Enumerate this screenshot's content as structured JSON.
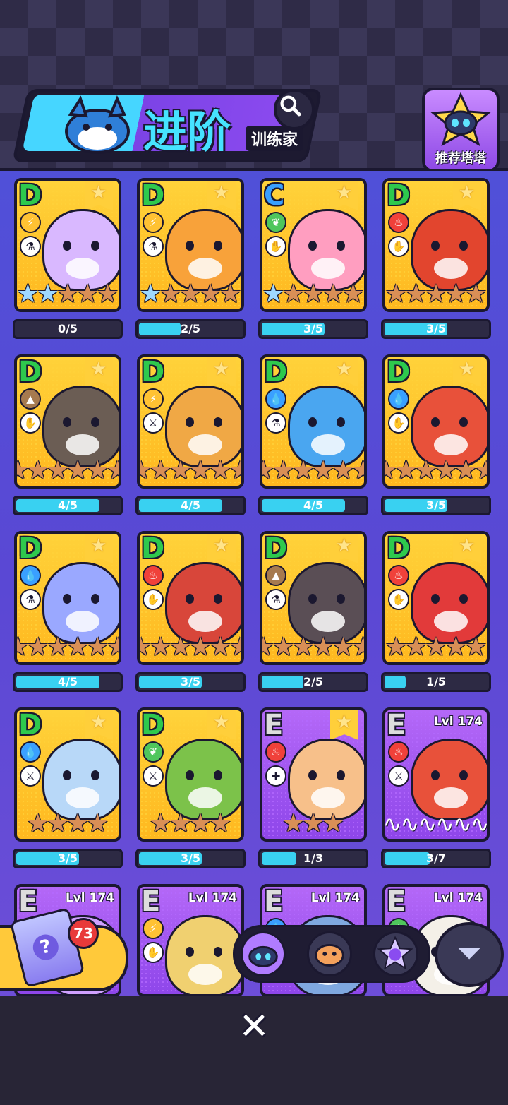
{
  "header": {
    "title": "进阶",
    "subtitle": "训练家",
    "recommend_label": "推荐塔塔"
  },
  "cards": [
    {
      "rank": "D",
      "element": "lightning",
      "role": "potion",
      "favorite": true,
      "stars": 5,
      "blue_stars": 2,
      "progress": "0/5",
      "progress_value": 0.0,
      "pet_color": "#d9b8ff"
    },
    {
      "rank": "D",
      "element": "lightning",
      "role": "potion",
      "favorite": true,
      "stars": 5,
      "blue_stars": 1,
      "progress": "2/5",
      "progress_value": 0.4,
      "pet_color": "#f8a23a"
    },
    {
      "rank": "C",
      "element": "leaf",
      "role": "claw",
      "favorite": true,
      "stars": 5,
      "blue_stars": 1,
      "progress": "3/5",
      "progress_value": 0.6,
      "pet_color": "#ff9ec0"
    },
    {
      "rank": "D",
      "element": "fire",
      "role": "claw",
      "favorite": true,
      "stars": 5,
      "blue_stars": 0,
      "progress": "3/5",
      "progress_value": 0.6,
      "pet_color": "#e2452e"
    },
    {
      "rank": "D",
      "element": "earth",
      "role": "claw",
      "favorite": true,
      "stars": 6,
      "blue_stars": 0,
      "progress": "4/5",
      "progress_value": 0.8,
      "pet_color": "#6b5d54"
    },
    {
      "rank": "D",
      "element": "lightning",
      "role": "sword",
      "favorite": true,
      "stars": 6,
      "blue_stars": 0,
      "progress": "4/5",
      "progress_value": 0.8,
      "pet_color": "#f0a845"
    },
    {
      "rank": "D",
      "element": "water",
      "role": "potion",
      "favorite": true,
      "stars": 6,
      "blue_stars": 0,
      "progress": "4/5",
      "progress_value": 0.8,
      "pet_color": "#4aa6f0"
    },
    {
      "rank": "D",
      "element": "water",
      "role": "claw",
      "favorite": true,
      "stars": 6,
      "blue_stars": 0,
      "progress": "3/5",
      "progress_value": 0.6,
      "pet_color": "#e8513a"
    },
    {
      "rank": "D",
      "element": "water",
      "role": "potion",
      "favorite": true,
      "stars": 6,
      "blue_stars": 0,
      "progress": "4/5",
      "progress_value": 0.8,
      "pet_color": "#9aa8ff"
    },
    {
      "rank": "D",
      "element": "fire",
      "role": "claw",
      "favorite": true,
      "stars": 6,
      "blue_stars": 0,
      "progress": "3/5",
      "progress_value": 0.6,
      "pet_color": "#d8463a"
    },
    {
      "rank": "D",
      "element": "earth",
      "role": "potion",
      "favorite": true,
      "stars": 6,
      "blue_stars": 0,
      "progress": "2/5",
      "progress_value": 0.4,
      "pet_color": "#5a4e55"
    },
    {
      "rank": "D",
      "element": "fire",
      "role": "claw",
      "favorite": true,
      "stars": 5,
      "blue_stars": 0,
      "progress": "1/5",
      "progress_value": 0.2,
      "pet_color": "#e23a3a"
    },
    {
      "rank": "D",
      "element": "water",
      "role": "sword",
      "favorite": true,
      "stars": 4,
      "blue_stars": 0,
      "progress": "3/5",
      "progress_value": 0.6,
      "pet_color": "#b8d8f8"
    },
    {
      "rank": "D",
      "element": "leaf",
      "role": "sword",
      "favorite": true,
      "stars": 4,
      "blue_stars": 0,
      "progress": "3/5",
      "progress_value": 0.6,
      "pet_color": "#7cc24a"
    },
    {
      "rank": "E",
      "element": "fire",
      "role": "heal",
      "favorite": true,
      "stars": 3,
      "blue_stars": 0,
      "progress": "1/3",
      "progress_value": 0.33,
      "pet_color": "#f7c08a"
    },
    {
      "rank": "E",
      "element": "fire",
      "role": "sword",
      "favorite": false,
      "level": "Lvl 174",
      "stars": 0,
      "blue_stars": 0,
      "waves": 6,
      "progress": "3/7",
      "progress_value": 0.43,
      "pet_color": "#e8513a"
    },
    {
      "rank": "E",
      "element": "earth",
      "role": "claw",
      "favorite": false,
      "level": "Lvl 174",
      "stars": 0,
      "blue_stars": 0,
      "progress": "",
      "progress_value": 0,
      "pet_color": "#cfa0ff"
    },
    {
      "rank": "E",
      "element": "lightning",
      "role": "claw",
      "favorite": false,
      "level": "Lvl 174",
      "stars": 0,
      "blue_stars": 0,
      "progress": "",
      "progress_value": 0,
      "pet_color": "#f0d070"
    },
    {
      "rank": "E",
      "element": "water",
      "role": "claw",
      "favorite": false,
      "level": "Lvl 174",
      "stars": 0,
      "blue_stars": 0,
      "progress": "",
      "progress_value": 0,
      "pet_color": "#7fa8e0"
    },
    {
      "rank": "E",
      "element": "leaf",
      "role": "claw",
      "favorite": false,
      "level": "Lvl 174",
      "stars": 0,
      "blue_stars": 0,
      "progress": "",
      "progress_value": 0,
      "pet_color": "#f4f0e8"
    }
  ],
  "lucky_box": {
    "count": "73"
  },
  "element_colors": {
    "lightning": "#ffc233",
    "leaf": "#4fc65c",
    "fire": "#f0413a",
    "earth": "#a67a4f",
    "water": "#3aa0ff"
  },
  "tabs": [
    {
      "icon": "pet-cat-icon",
      "color": "#b07cff"
    },
    {
      "icon": "hamster-icon",
      "color": "#3a3956"
    },
    {
      "icon": "star-badge-icon",
      "color": "#3a3956"
    }
  ],
  "close_label": "✕"
}
